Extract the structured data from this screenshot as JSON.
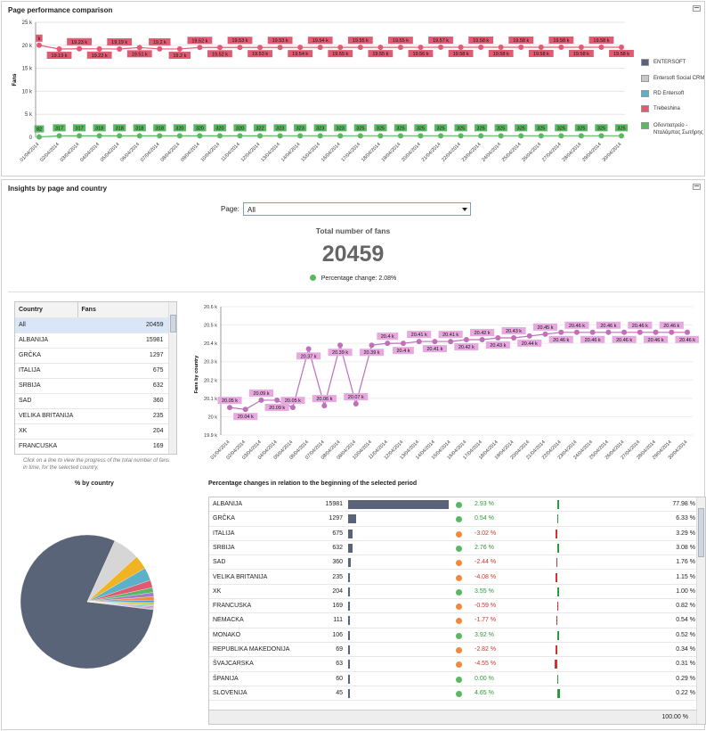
{
  "panel1": {
    "title": "Page performance comparison",
    "legend": [
      {
        "label": "ENTERSOFT",
        "color": "#5a6478"
      },
      {
        "label": "Entersoft Social CRM",
        "color": "#c8c8c8"
      },
      {
        "label": "RD Entersoft",
        "color": "#5ab1c8"
      },
      {
        "label": "Trebeshina",
        "color": "#e05a72"
      },
      {
        "label": "Οδοντιατρείο - Νταλάμπας Σωτήρης",
        "color": "#5ab862"
      }
    ]
  },
  "chart_data": [
    {
      "type": "line",
      "ylabel": "Fans",
      "ylim": [
        0,
        25000
      ],
      "yticks": [
        "25 k",
        "20 k",
        "15 k",
        "10 k",
        "5 k",
        "0"
      ],
      "x": [
        "01/04/2014",
        "02/04/2014",
        "03/04/2014",
        "04/04/2014",
        "05/04/2014",
        "06/04/2014",
        "07/04/2014",
        "08/04/2014",
        "09/04/2014",
        "10/04/2014",
        "11/04/2014",
        "12/04/2014",
        "13/04/2014",
        "14/04/2014",
        "15/04/2014",
        "16/04/2014",
        "17/04/2014",
        "18/04/2014",
        "19/04/2014",
        "20/04/2014",
        "21/04/2014",
        "22/04/2014",
        "23/04/2014",
        "24/04/2014",
        "25/04/2014",
        "26/04/2014",
        "27/04/2014",
        "28/04/2014",
        "29/04/2014",
        "30/04/2014"
      ],
      "series": [
        {
          "name": "Trebeshina",
          "color": "#e05a72",
          "values": [
            20000,
            19190,
            19230,
            19220,
            19190,
            19510,
            19200,
            19200,
            19520,
            19520,
            19530,
            19530,
            19530,
            19540,
            19540,
            19550,
            19550,
            19550,
            19550,
            19560,
            19570,
            19580,
            19580,
            19580,
            19580,
            19580,
            19580,
            19580,
            19580,
            19580
          ],
          "labels": [
            "k",
            "19.19 k",
            "19.23 k",
            "19.22 k",
            "19.19 k",
            "19.51 k",
            "19.2 k",
            "19.2 k",
            "19.52 k",
            "19.52 k",
            "19.53 k",
            "19.53 k",
            "19.53 k",
            "19.54 k",
            "19.54 k",
            "19.55 k",
            "19.55 k",
            "19.55 k",
            "19.55 k",
            "19.56 k",
            "19.57 k",
            "19.58 k",
            "19.58 k",
            "19.58 k",
            "19.58 k",
            "19.58 k",
            "19.58 k",
            "19.58 k",
            "19.58 k",
            "19.58 k"
          ]
        },
        {
          "name": "Οδοντιατρείο - Νταλάμπας Σωτήρης",
          "color": "#5ab862",
          "values": [
            82,
            317,
            317,
            318,
            318,
            318,
            318,
            320,
            320,
            320,
            320,
            322,
            323,
            323,
            323,
            323,
            325,
            325,
            325,
            325,
            325,
            325,
            325,
            325,
            325,
            325,
            325,
            325,
            325,
            325
          ],
          "labels": [
            "82",
            "317",
            "317",
            "318",
            "318",
            "318",
            "318",
            "320",
            "320",
            "320",
            "320",
            "322",
            "323",
            "323",
            "323",
            "323",
            "325",
            "325",
            "325",
            "325",
            "325",
            "325",
            "325",
            "325",
            "325",
            "325",
            "325",
            "325",
            "325",
            "325"
          ]
        }
      ]
    },
    {
      "type": "line",
      "ylabel": "Fans by country",
      "ylim": [
        19900,
        20600
      ],
      "yticks": [
        "20.6 k",
        "20.5 k",
        "20.4 k",
        "20.3 k",
        "20.2 k",
        "20.1 k",
        "20 k",
        "19.9 k"
      ],
      "x": [
        "01/04/2014",
        "02/04/2014",
        "03/04/2014",
        "04/04/2014",
        "05/04/2014",
        "06/04/2014",
        "07/04/2014",
        "08/04/2014",
        "09/04/2014",
        "10/04/2014",
        "11/04/2014",
        "12/04/2014",
        "13/04/2014",
        "14/04/2014",
        "15/04/2014",
        "16/04/2014",
        "17/04/2014",
        "18/04/2014",
        "19/04/2014",
        "20/04/2014",
        "21/04/2014",
        "22/04/2014",
        "23/04/2014",
        "24/04/2014",
        "25/04/2014",
        "26/04/2014",
        "27/04/2014",
        "28/04/2014",
        "29/04/2014",
        "30/04/2014"
      ],
      "series": [
        {
          "name": "Fans",
          "color": "#c06fb8",
          "values": [
            20050,
            20040,
            20090,
            20090,
            20050,
            20370,
            20060,
            20390,
            20070,
            20390,
            20400,
            20400,
            20410,
            20410,
            20410,
            20420,
            20420,
            20430,
            20430,
            20440,
            20450,
            20460,
            20460,
            20460,
            20460,
            20460,
            20460,
            20460,
            20460,
            20460
          ],
          "labels": [
            "20.05 k",
            "20.04 k",
            "20.09 k",
            "20.09 k",
            "20.05 k",
            "20.37 k",
            "20.06 k",
            "20.39 k",
            "20.07 k",
            "20.39 k",
            "20.4 k",
            "20.4 k",
            "20.41 k",
            "20.41 k",
            "20.41 k",
            "20.42 k",
            "20.42 k",
            "20.43 k",
            "20.43 k",
            "20.44 k",
            "20.45 k",
            "20.46 k",
            "20.46 k",
            "20.46 k",
            "20.46 k",
            "20.46 k",
            "20.46 k",
            "20.46 k",
            "20.46 k",
            "20.46 k"
          ]
        }
      ]
    },
    {
      "type": "pie",
      "title": "% by country",
      "categories": [
        "ALBANIJA",
        "GRČKA",
        "ITALIJA",
        "SRBIJA",
        "SAD",
        "VELIKA BRITANIJA",
        "XK",
        "FRANCUSKA",
        "NEMAČKA",
        "MONAKO",
        "REPUBLIKA MAKEDONIJA",
        "ŠVAJCARSKA",
        "ŠPANIJA",
        "SLOVENIJA"
      ],
      "values": [
        77.98,
        6.33,
        3.29,
        3.08,
        1.76,
        1.15,
        1.0,
        0.82,
        0.54,
        0.52,
        0.34,
        0.31,
        0.29,
        0.22
      ],
      "colors": [
        "#5a6478",
        "#d6d6d6",
        "#f0b323",
        "#5ab1c8",
        "#e05a72",
        "#5ab862",
        "#a07fc8",
        "#f08a3c",
        "#3a9ad9",
        "#c8c84a",
        "#8ad0a0",
        "#d08ac0",
        "#7aa0d0",
        "#e0a0a0"
      ]
    }
  ],
  "panel2": {
    "title": "Insights by page and country",
    "page_label": "Page:",
    "page_value": "All",
    "total_title": "Total number of fans",
    "total_value": "20459",
    "pct_change_text": "Percentage change: 2.08%"
  },
  "country_table": {
    "headers": [
      "Country",
      "Fans"
    ],
    "rows": [
      {
        "country": "All",
        "fans": "20459"
      },
      {
        "country": "ALBANIJA",
        "fans": "15981"
      },
      {
        "country": "GRČKA",
        "fans": "1297"
      },
      {
        "country": "ITALIJA",
        "fans": "675"
      },
      {
        "country": "SRBIJA",
        "fans": "632"
      },
      {
        "country": "SAD",
        "fans": "360"
      },
      {
        "country": "VELIKA BRITANIJA",
        "fans": "235"
      },
      {
        "country": "XK",
        "fans": "204"
      },
      {
        "country": "FRANCUSKA",
        "fans": "169"
      }
    ],
    "hint": "Click on a line to view the progress of the total number of fans in time, for the selected country."
  },
  "pct_table": {
    "title": "Percentage changes in relation to the beginning of the selected period",
    "rows": [
      {
        "country": "ALBANIJA",
        "fans": "15981",
        "bar": 1.0,
        "change": "2.93 %",
        "dir": "up",
        "share": "77.98 %"
      },
      {
        "country": "GRČKA",
        "fans": "1297",
        "bar": 0.081,
        "change": "0.54 %",
        "dir": "up",
        "share": "6.33 %"
      },
      {
        "country": "ITALIJA",
        "fans": "675",
        "bar": 0.042,
        "change": "-3.02 %",
        "dir": "down",
        "share": "3.29 %"
      },
      {
        "country": "SRBIJA",
        "fans": "632",
        "bar": 0.04,
        "change": "2.76 %",
        "dir": "up",
        "share": "3.08 %"
      },
      {
        "country": "SAD",
        "fans": "360",
        "bar": 0.023,
        "change": "-2.44 %",
        "dir": "down",
        "share": "1.76 %"
      },
      {
        "country": "VELIKA BRITANIJA",
        "fans": "235",
        "bar": 0.015,
        "change": "-4.08 %",
        "dir": "down",
        "share": "1.15 %"
      },
      {
        "country": "XK",
        "fans": "204",
        "bar": 0.013,
        "change": "3.55 %",
        "dir": "up",
        "share": "1.00 %"
      },
      {
        "country": "FRANCUSKA",
        "fans": "169",
        "bar": 0.011,
        "change": "-0.59 %",
        "dir": "down",
        "share": "0.82 %"
      },
      {
        "country": "NEMACKA",
        "fans": "111",
        "bar": 0.007,
        "change": "-1.77 %",
        "dir": "down",
        "share": "0.54 %"
      },
      {
        "country": "MONAKO",
        "fans": "106",
        "bar": 0.007,
        "change": "3.92 %",
        "dir": "up",
        "share": "0.52 %"
      },
      {
        "country": "REPUBLIKA MAKEDONIJA",
        "fans": "69",
        "bar": 0.004,
        "change": "-2.82 %",
        "dir": "down",
        "share": "0.34 %"
      },
      {
        "country": "ŠVAJCARSKA",
        "fans": "63",
        "bar": 0.004,
        "change": "-4.55 %",
        "dir": "down",
        "share": "0.31 %"
      },
      {
        "country": "ŠPANIJA",
        "fans": "60",
        "bar": 0.004,
        "change": "0.00 %",
        "dir": "up",
        "share": "0.29 %"
      },
      {
        "country": "SLOVENIJA",
        "fans": "45",
        "bar": 0.003,
        "change": "4.65 %",
        "dir": "up",
        "share": "0.22 %"
      }
    ],
    "total": "100.00 %"
  }
}
